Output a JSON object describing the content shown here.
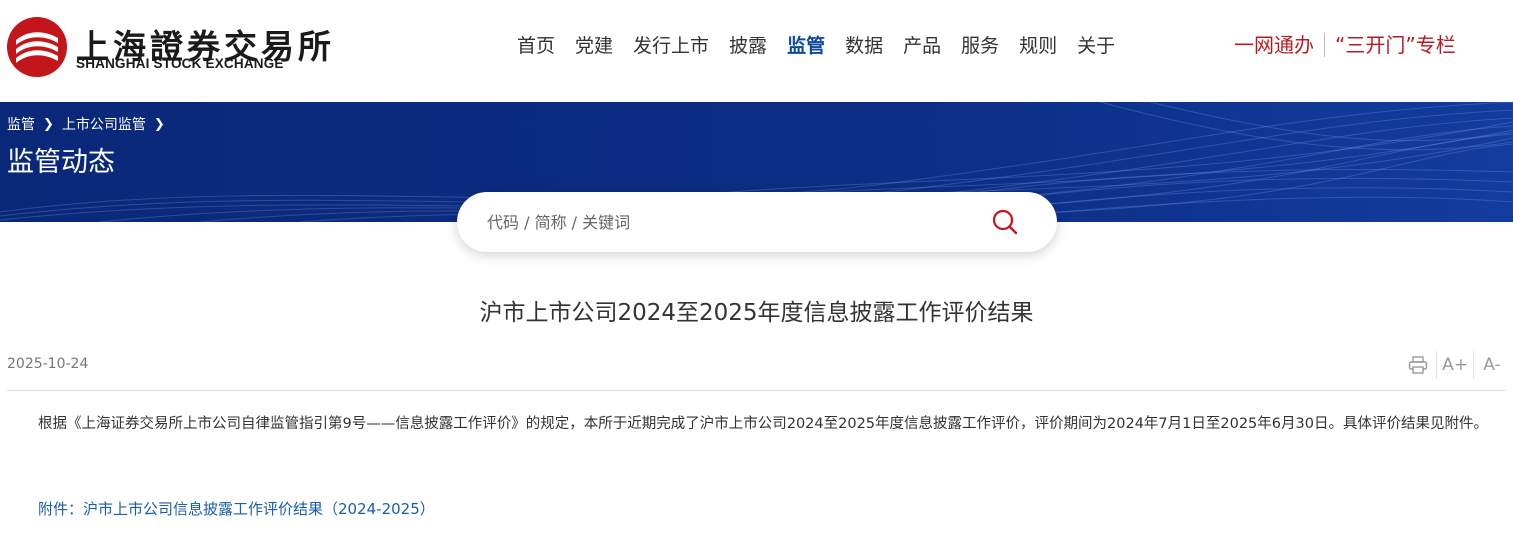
{
  "logo": {
    "cn": "上海證券交易所",
    "en": "SHANGHAI STOCK EXCHANGE",
    "brand_color": "#c3161c"
  },
  "nav": {
    "items": [
      {
        "label": "首页",
        "active": false
      },
      {
        "label": "党建",
        "active": false
      },
      {
        "label": "发行上市",
        "active": false
      },
      {
        "label": "披露",
        "active": false
      },
      {
        "label": "监管",
        "active": true
      },
      {
        "label": "数据",
        "active": false
      },
      {
        "label": "产品",
        "active": false
      },
      {
        "label": "服务",
        "active": false
      },
      {
        "label": "规则",
        "active": false
      },
      {
        "label": "关于",
        "active": false
      }
    ],
    "active_color": "#0d4a9c"
  },
  "topright": {
    "link1": "一网通办",
    "link2": "“三开门”专栏",
    "color": "#b81c22"
  },
  "banner": {
    "breadcrumb": [
      "监管",
      "上市公司监管"
    ],
    "title": "监管动态",
    "bg_color": "#0a2a7d"
  },
  "search": {
    "placeholder": "代码 / 简称 / 关键词",
    "icon": "search-icon",
    "icon_color": "#c3161c"
  },
  "article": {
    "title": "沪市上市公司2024至2025年度信息披露工作评价结果",
    "date": "2025-10-24",
    "tools": {
      "print_icon": "print-icon",
      "font_increase": "A+",
      "font_decrease": "A-"
    },
    "body": "根据《上海证券交易所上市公司自律监管指引第9号——信息披露工作评价》的规定，本所于近期完成了沪市上市公司2024至2025年度信息披露工作评价，评价期间为2024年7月1日至2025年6月30日。具体评价结果见附件。",
    "attachment": "附件：沪市上市公司信息披露工作评价结果（2024-2025）",
    "link_color": "#1a5ea8"
  }
}
